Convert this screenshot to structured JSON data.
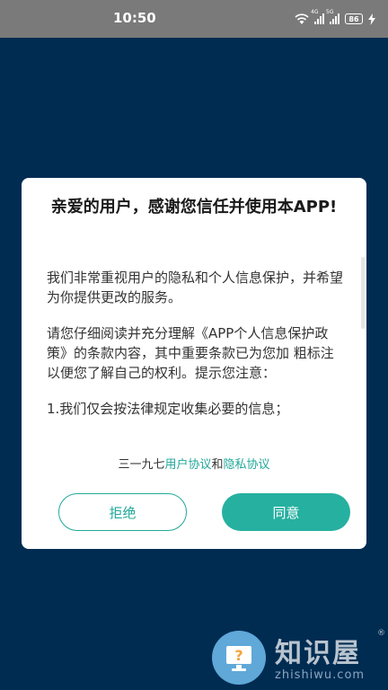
{
  "status_bar": {
    "time": "10:50",
    "signal_1_tag": "4G",
    "signal_2_tag": "5G",
    "battery": "86"
  },
  "dialog": {
    "title": "亲爱的用户，感谢您信任并使用本APP!",
    "paragraphs": [
      "我们非常重视用户的隐私和个人信息保护，并希望为你提供更改的服务。",
      "请您仔细阅读并充分理解《APP个人信息保护政策》的条款内容，其中重要条款已为您加 粗标注以便您了解自己的权利。提示您注意：",
      "1.我们仅会按法律规定收集必要的信息；"
    ],
    "links_prefix": "三一九七",
    "link_user_agreement": "用户协议",
    "links_and": "和",
    "link_privacy_agreement": "隐私协议",
    "reject_label": "拒绝",
    "agree_label": "同意"
  },
  "watermark": {
    "title": "知识屋",
    "subtitle": "zhishiwu.com",
    "reg": "®"
  },
  "colors": {
    "background": "#002c52",
    "status_bar": "#7a7a7a",
    "accent": "#26b0a0"
  }
}
